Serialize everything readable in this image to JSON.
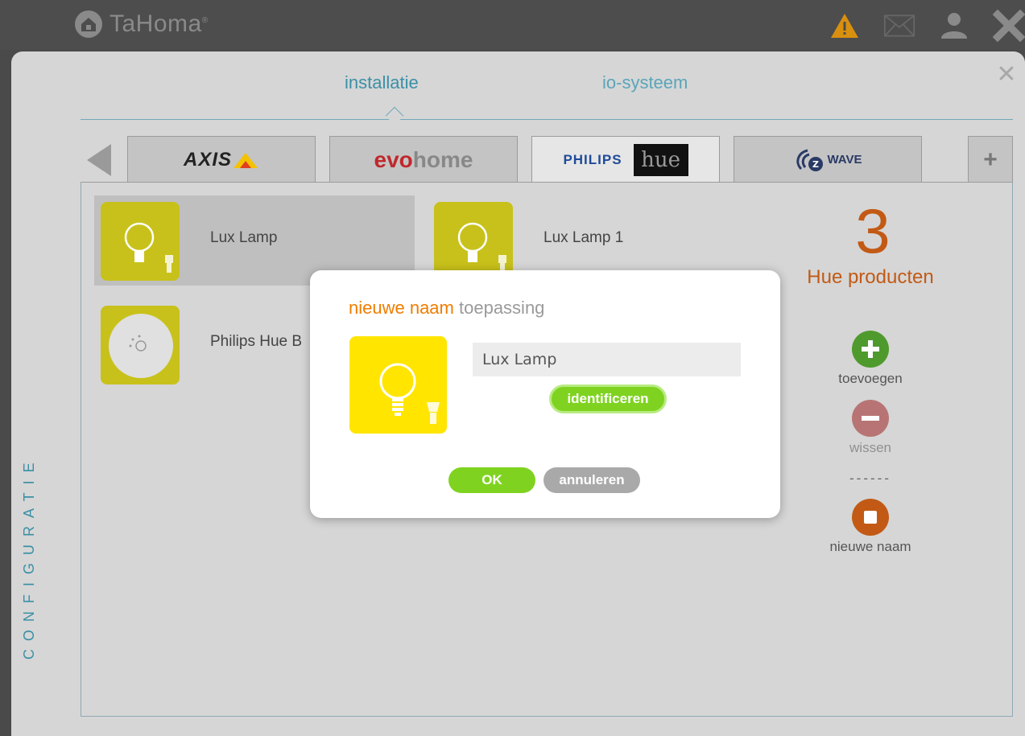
{
  "app": {
    "name": "TaHoma",
    "reg_mark": "®"
  },
  "colors": {
    "accent_orange": "#ef7d00",
    "accent_blue": "#3b90a7",
    "green": "#7fd320",
    "tile_yellow": "#ffe500"
  },
  "top_icons": [
    "warning-icon",
    "mail-icon",
    "user-icon",
    "close-icon"
  ],
  "view_tabs": [
    {
      "label": "installatie",
      "active": true
    },
    {
      "label": "io-systeem",
      "active": false
    }
  ],
  "brand_tabs": [
    {
      "name": "AXIS",
      "active": false
    },
    {
      "name_a": "evo",
      "name_b": "home",
      "active": false
    },
    {
      "name_a": "PHILIPS",
      "name_b": "hue",
      "active": true
    },
    {
      "name": "WAVE",
      "active": false
    }
  ],
  "add_tab_label": "+",
  "side_label": "CONFIGURATIE",
  "devices": [
    {
      "name": "Lux Lamp",
      "selected": true
    },
    {
      "name": "Lux Lamp 1",
      "selected": false
    },
    {
      "name": "Philips Hue B",
      "selected": false
    }
  ],
  "summary": {
    "count": "3",
    "label": "Hue producten"
  },
  "actions": {
    "add": "toevoegen",
    "delete": "wissen",
    "separator": "------",
    "rename": "nieuwe naam"
  },
  "modal": {
    "title_a": "nieuwe naam",
    "title_b": "toepassing",
    "name_value": "Lux Lamp",
    "identify_label": "identificeren",
    "ok_label": "OK",
    "cancel_label": "annuleren"
  }
}
